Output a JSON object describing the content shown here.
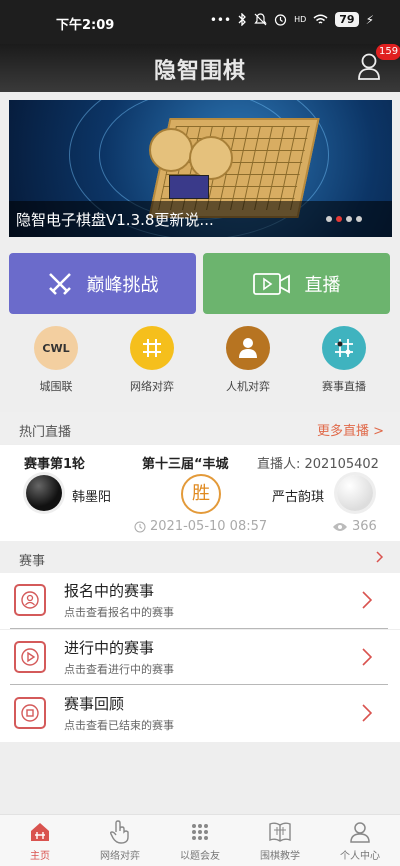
{
  "status_bar": {
    "time": "下午2:09",
    "icons": [
      "dots-icon",
      "bluetooth-icon",
      "mute-icon",
      "alarm-icon",
      "hd-icon",
      "wifi-icon"
    ],
    "battery": "79"
  },
  "header": {
    "title": "隐智围棋",
    "notification_count": "159"
  },
  "banner": {
    "caption": "隐智电子棋盘V1.3.8更新说...",
    "dots_total": 4,
    "active_dot": 1
  },
  "actions": {
    "challenge_label": "巅峰挑战",
    "live_label": "直播"
  },
  "quick_menu": [
    {
      "label": "城围联",
      "icon": "cwl-logo-icon",
      "color": "#f3cfa0"
    },
    {
      "label": "网络对弈",
      "icon": "grid-icon",
      "color": "#f5bf1c"
    },
    {
      "label": "人机对弈",
      "icon": "person-icon",
      "color": "#b77421"
    },
    {
      "label": "赛事直播",
      "icon": "board-broadcast-icon",
      "color": "#3fb3bf"
    }
  ],
  "hot_live": {
    "title": "热门直播",
    "more": "更多直播 >",
    "round": "赛事第1轮",
    "event": "第十三届“丰城",
    "streamer": "直播人: 202105402",
    "black_player": "韩墨阳",
    "white_player": "严古韵琪",
    "result": "胜",
    "datetime": "2021-05-10 08:57",
    "views": "366"
  },
  "events": {
    "title": "赛事",
    "items": [
      {
        "title": "报名中的赛事",
        "subtitle": "点击查看报名中的赛事",
        "icon": "signup-icon"
      },
      {
        "title": "进行中的赛事",
        "subtitle": "点击查看进行中的赛事",
        "icon": "play-icon"
      },
      {
        "title": "赛事回顾",
        "subtitle": "点击查看已结束的赛事",
        "icon": "stop-icon"
      }
    ]
  },
  "tabbar": {
    "items": [
      {
        "label": "主页",
        "icon": "home-icon",
        "active": true
      },
      {
        "label": "网络对弈",
        "icon": "hand-icon",
        "active": false
      },
      {
        "label": "以题会友",
        "icon": "puzzle-icon",
        "active": false
      },
      {
        "label": "围棋教学",
        "icon": "book-icon",
        "active": false
      },
      {
        "label": "个人中心",
        "icon": "profile-icon",
        "active": false
      }
    ]
  },
  "colors": {
    "accent": "#d9534f",
    "challenge": "#6b6bcb",
    "live": "#6cb46e"
  }
}
